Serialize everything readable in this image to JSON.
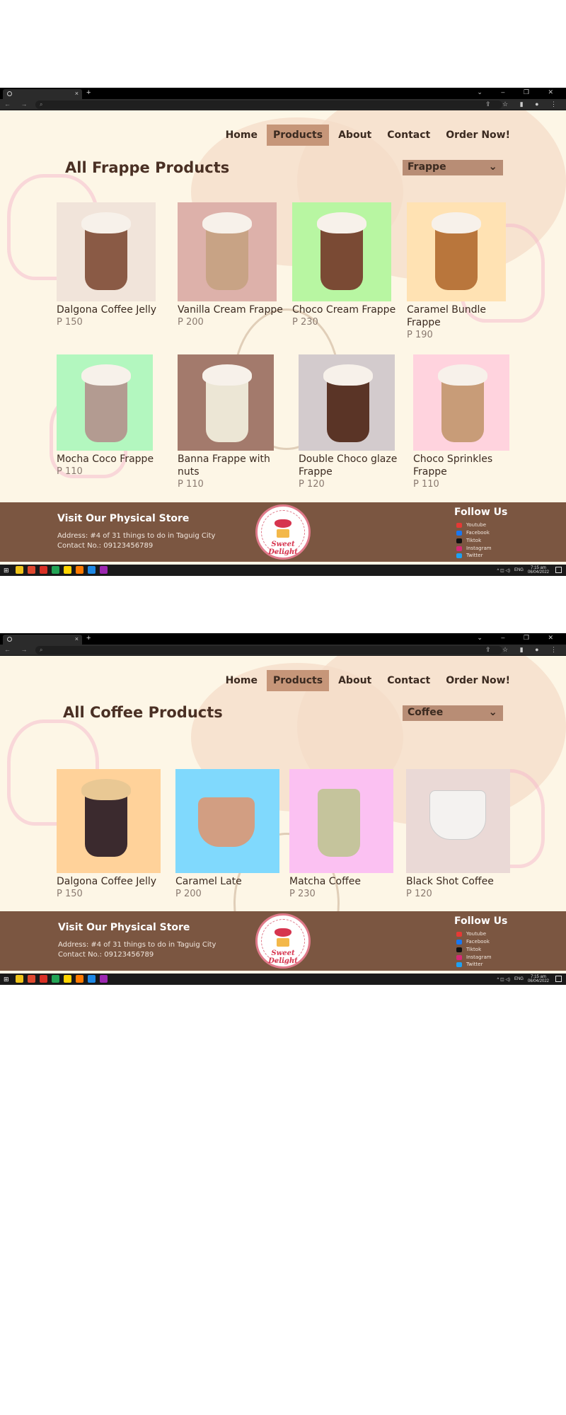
{
  "colors": {
    "page_bg": "#fdf6e6",
    "accent": "#c69679",
    "select_bg": "#b88d75",
    "footer_bg": "#7b5641",
    "heading": "#4a3024"
  },
  "browser": {
    "new_tab": "+",
    "close_tab": "×",
    "window_controls": "⌄ – ❐ ✕",
    "nav_buttons": "← → ⟳",
    "toolbar_icons": "⇪ ☆ ▮ ● ⋮"
  },
  "nav": {
    "items": [
      "Home",
      "Products",
      "About",
      "Contact",
      "Order Now!"
    ],
    "active": "Products"
  },
  "screens": [
    {
      "heading": "All Frappe Products",
      "select_value": "Frappe",
      "products": [
        {
          "name": "Dalgona Coffee Jelly",
          "price": "P 150",
          "bg": "#f1e4da",
          "cup": "#8a5a45"
        },
        {
          "name": "Vanilla Cream Frappe",
          "price": "P 200",
          "bg": "#ddb1aa",
          "cup": "#c8a385"
        },
        {
          "name": "Choco Cream Frappe",
          "price": "P 230",
          "bg": "#b8f6a2",
          "cup": "#7a4a34"
        },
        {
          "name": "Caramel Bundle Frappe",
          "price": "P 190",
          "bg": "#ffe2b3",
          "cup": "#b9763c"
        },
        {
          "name": "Mocha Coco Frappe",
          "price": "P 110",
          "bg": "#b3f7bf",
          "cup": "#b39b91"
        },
        {
          "name": "Banna Frappe with nuts",
          "price": "P 110",
          "bg": "#a37a6c",
          "cup": "#ece6d5"
        },
        {
          "name": "Double Choco glaze Frappe",
          "price": "P 120",
          "bg": "#d3cbcd",
          "cup": "#5a3426"
        },
        {
          "name": "Choco Sprinkles Frappe",
          "price": "P 110",
          "bg": "#ffd3de",
          "cup": "#c89c78"
        }
      ]
    },
    {
      "heading": "All Coffee Products",
      "select_value": "Coffee",
      "products": [
        {
          "name": "Dalgona Coffee Jelly",
          "price": "P 150",
          "bg": "#ffd29a",
          "cup": "#3b2a2e"
        },
        {
          "name": "Caramel Late",
          "price": "P 200",
          "bg": "#80d9fd",
          "cup": "#d29e82"
        },
        {
          "name": "Matcha Coffee",
          "price": "P 230",
          "bg": "#fbc1f2",
          "cup": "#c5c49c"
        },
        {
          "name": "Black Shot Coffee",
          "price": "P 120",
          "bg": "#ead9d6",
          "cup": "#f4f2f0"
        }
      ]
    }
  ],
  "footer": {
    "store_title": "Visit Our Physical Store",
    "address": "Address: #4 of 31 things to do in Taguig City",
    "contact": "Contact No.: 09123456789",
    "logo_text": "Sweet Delight",
    "follow_title": "Follow Us",
    "socials": [
      {
        "label": "Youtube",
        "icon": "youtube-icon",
        "color": "#e53935"
      },
      {
        "label": "Facebook",
        "icon": "facebook-icon",
        "color": "#1877f2"
      },
      {
        "label": "Tiktok",
        "icon": "tiktok-icon",
        "color": "#111111"
      },
      {
        "label": "Instagram",
        "icon": "instagram-icon",
        "color": "#d62976"
      },
      {
        "label": "Twitter",
        "icon": "twitter-icon",
        "color": "#1da1f2"
      }
    ]
  },
  "taskbar": {
    "start": "⊞",
    "lang": "ENG",
    "time": "7:15 am",
    "date": "06/04/2022",
    "tray": "^ ◫ ◁)",
    "apps": [
      "#f0c419",
      "#e0492f",
      "#d93025",
      "#23a455",
      "#ffd400",
      "#ff7a00",
      "#1e88e5",
      "#9c27b0"
    ]
  }
}
